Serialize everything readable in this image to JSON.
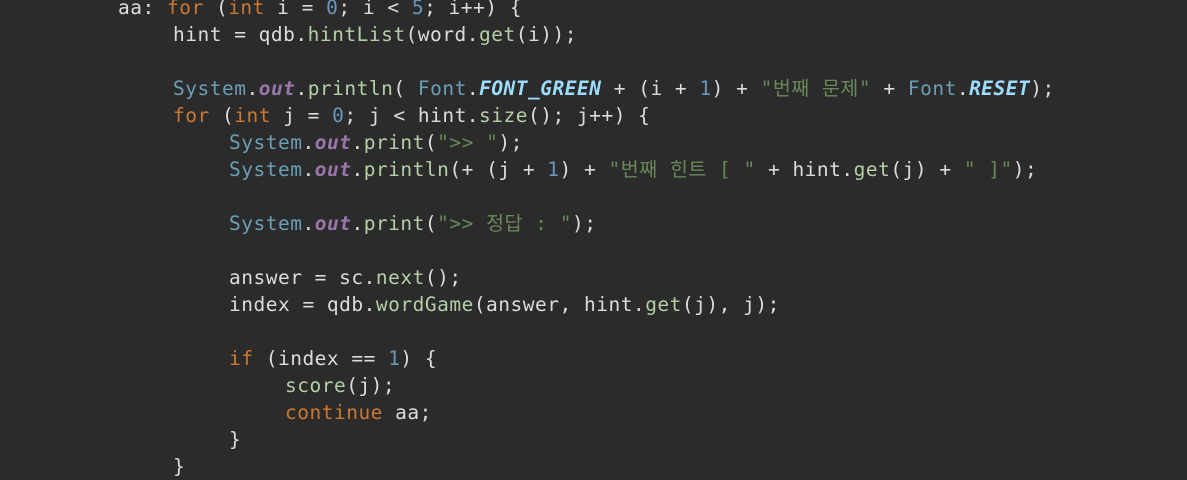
{
  "editor": {
    "lines": [
      [
        {
          "t": "aa: ",
          "c": "plain"
        },
        {
          "t": "for",
          "c": "kw"
        },
        {
          "t": " (",
          "c": "plain"
        },
        {
          "t": "int",
          "c": "kw"
        },
        {
          "t": " i = ",
          "c": "plain"
        },
        {
          "t": "0",
          "c": "num"
        },
        {
          "t": "; i < ",
          "c": "plain"
        },
        {
          "t": "5",
          "c": "num"
        },
        {
          "t": "; i++) {",
          "c": "plain"
        }
      ],
      [
        {
          "t": "hint = qdb.",
          "c": "plain"
        },
        {
          "t": "hintList",
          "c": "mth"
        },
        {
          "t": "(word.",
          "c": "plain"
        },
        {
          "t": "get",
          "c": "mth"
        },
        {
          "t": "(i));",
          "c": "plain"
        }
      ],
      [],
      [
        {
          "t": "System",
          "c": "cls"
        },
        {
          "t": ".",
          "c": "plain"
        },
        {
          "t": "out",
          "c": "fld"
        },
        {
          "t": ".",
          "c": "plain"
        },
        {
          "t": "println",
          "c": "mth"
        },
        {
          "t": "( ",
          "c": "plain"
        },
        {
          "t": "Font",
          "c": "cls"
        },
        {
          "t": ".",
          "c": "plain"
        },
        {
          "t": "FONT_GREEN",
          "c": "cst"
        },
        {
          "t": " + (i + ",
          "c": "plain"
        },
        {
          "t": "1",
          "c": "num"
        },
        {
          "t": ") + ",
          "c": "plain"
        },
        {
          "t": "\"번째 문제\"",
          "c": "str"
        },
        {
          "t": " + ",
          "c": "plain"
        },
        {
          "t": "Font",
          "c": "cls"
        },
        {
          "t": ".",
          "c": "plain"
        },
        {
          "t": "RESET",
          "c": "cst"
        },
        {
          "t": ");",
          "c": "plain"
        }
      ],
      [
        {
          "t": "for",
          "c": "kw"
        },
        {
          "t": " (",
          "c": "plain"
        },
        {
          "t": "int",
          "c": "kw"
        },
        {
          "t": " j = ",
          "c": "plain"
        },
        {
          "t": "0",
          "c": "num"
        },
        {
          "t": "; j < hint.",
          "c": "plain"
        },
        {
          "t": "size",
          "c": "mth"
        },
        {
          "t": "(); j++) {",
          "c": "plain"
        }
      ],
      [
        {
          "t": "System",
          "c": "cls"
        },
        {
          "t": ".",
          "c": "plain"
        },
        {
          "t": "out",
          "c": "fld"
        },
        {
          "t": ".",
          "c": "plain"
        },
        {
          "t": "print",
          "c": "mth"
        },
        {
          "t": "(",
          "c": "plain"
        },
        {
          "t": "\">> \"",
          "c": "str"
        },
        {
          "t": ");",
          "c": "plain"
        }
      ],
      [
        {
          "t": "System",
          "c": "cls"
        },
        {
          "t": ".",
          "c": "plain"
        },
        {
          "t": "out",
          "c": "fld"
        },
        {
          "t": ".",
          "c": "plain"
        },
        {
          "t": "println",
          "c": "mth"
        },
        {
          "t": "(+ (j + ",
          "c": "plain"
        },
        {
          "t": "1",
          "c": "num"
        },
        {
          "t": ") + ",
          "c": "plain"
        },
        {
          "t": "\"번째 힌트 [ \"",
          "c": "str"
        },
        {
          "t": " + hint.",
          "c": "plain"
        },
        {
          "t": "get",
          "c": "mth"
        },
        {
          "t": "(j) + ",
          "c": "plain"
        },
        {
          "t": "\" ]\"",
          "c": "str"
        },
        {
          "t": ");",
          "c": "plain"
        }
      ],
      [],
      [
        {
          "t": "System",
          "c": "cls"
        },
        {
          "t": ".",
          "c": "plain"
        },
        {
          "t": "out",
          "c": "fld"
        },
        {
          "t": ".",
          "c": "plain"
        },
        {
          "t": "print",
          "c": "mth"
        },
        {
          "t": "(",
          "c": "plain"
        },
        {
          "t": "\">> 정답 : \"",
          "c": "str"
        },
        {
          "t": ");",
          "c": "plain"
        }
      ],
      [],
      [
        {
          "t": "answer = sc.",
          "c": "plain"
        },
        {
          "t": "next",
          "c": "mth"
        },
        {
          "t": "();",
          "c": "plain"
        }
      ],
      [
        {
          "t": "index = qdb.",
          "c": "plain"
        },
        {
          "t": "wordGame",
          "c": "mth"
        },
        {
          "t": "(answer, hint.",
          "c": "plain"
        },
        {
          "t": "get",
          "c": "mth"
        },
        {
          "t": "(j), j);",
          "c": "plain"
        }
      ],
      [],
      [
        {
          "t": "if",
          "c": "kw"
        },
        {
          "t": " (index == ",
          "c": "plain"
        },
        {
          "t": "1",
          "c": "num"
        },
        {
          "t": ") {",
          "c": "plain"
        }
      ],
      [
        {
          "t": "score",
          "c": "mth"
        },
        {
          "t": "(j);",
          "c": "plain"
        }
      ],
      [
        {
          "t": "continue",
          "c": "kw"
        },
        {
          "t": " aa;",
          "c": "plain"
        }
      ],
      [
        {
          "t": "}",
          "c": "plain"
        }
      ],
      [
        {
          "t": "}",
          "c": "plain"
        }
      ]
    ]
  }
}
